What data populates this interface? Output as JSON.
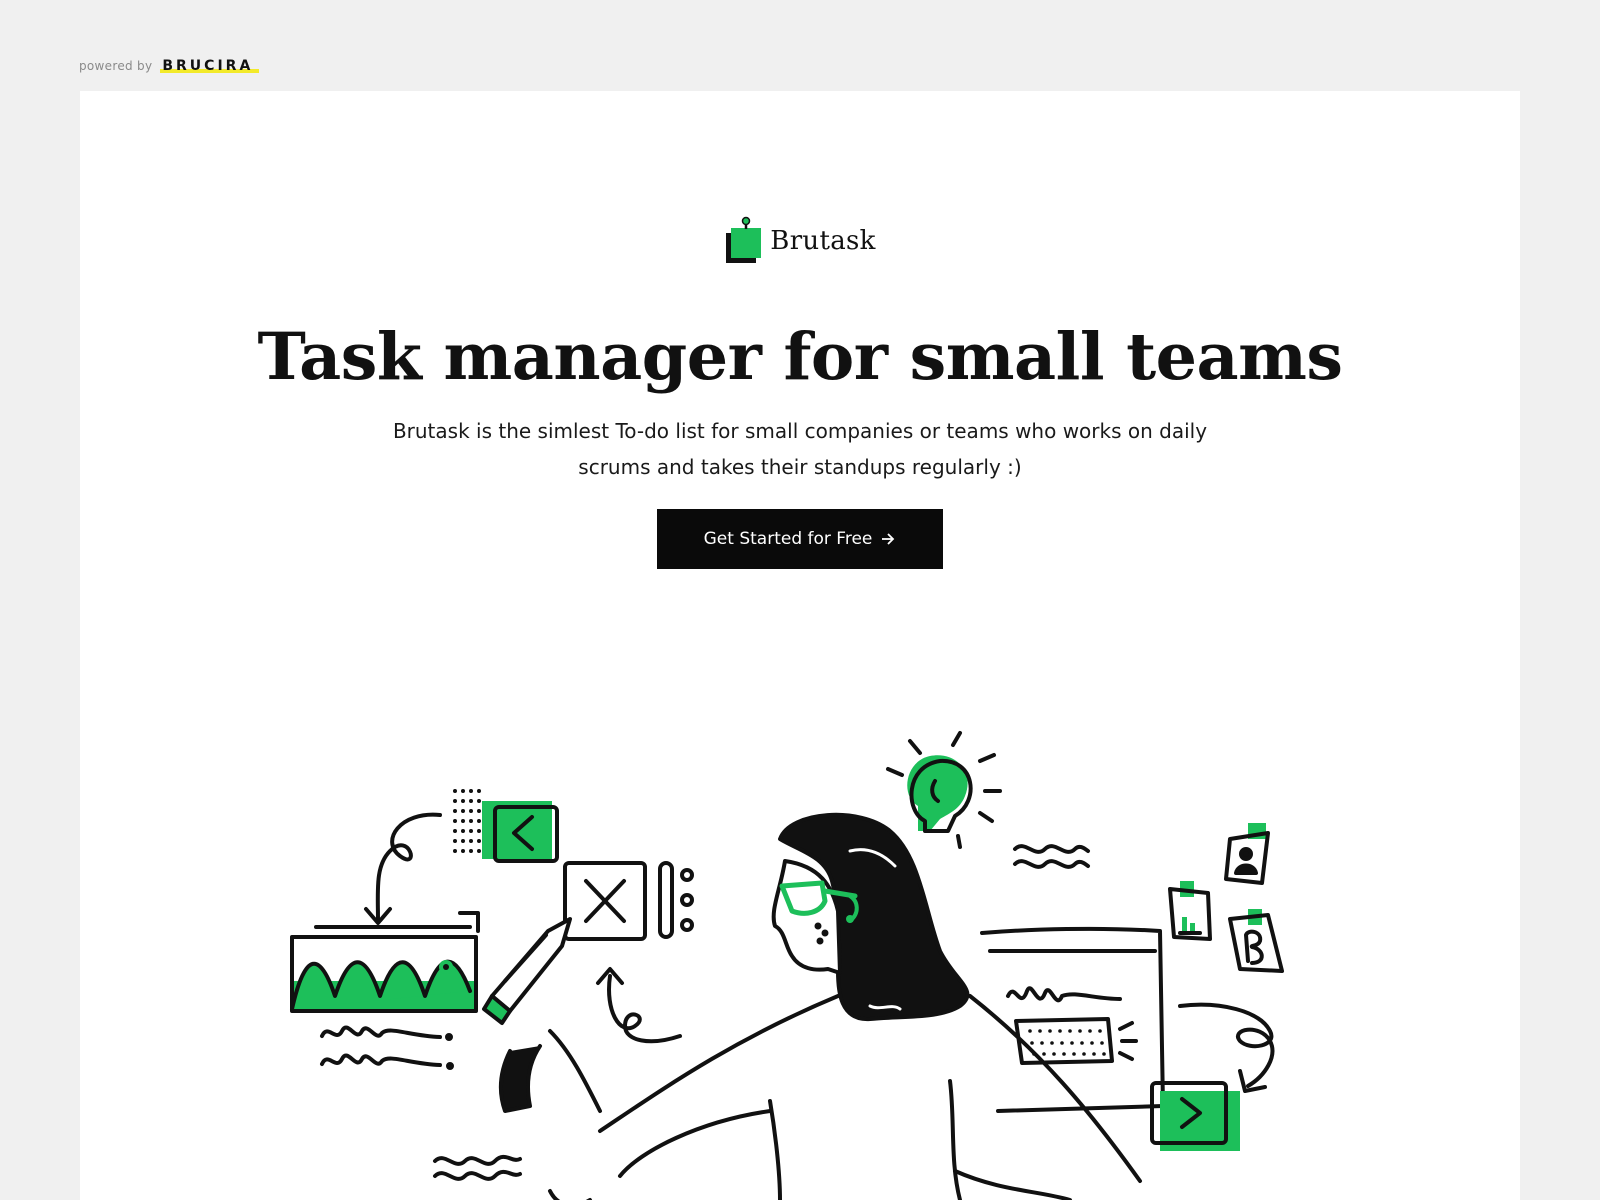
{
  "powered_by": {
    "label": "powered by",
    "brand": "BRUCIRA"
  },
  "logo": {
    "name": "Brutask"
  },
  "hero": {
    "headline": "Task manager for small teams",
    "subtitle": "Brutask is the simlest To-do list for small companies or teams who works on daily scrums and takes their standups regularly :)",
    "cta_label": "Get Started for Free",
    "cta_icon": "arrow-right-icon"
  },
  "colors": {
    "accent": "#1dbf5a",
    "background": "#f0f0f0",
    "card": "#ffffff",
    "text": "#111111",
    "button": "#0a0a0a",
    "brand_highlight": "#f3ea2a"
  }
}
